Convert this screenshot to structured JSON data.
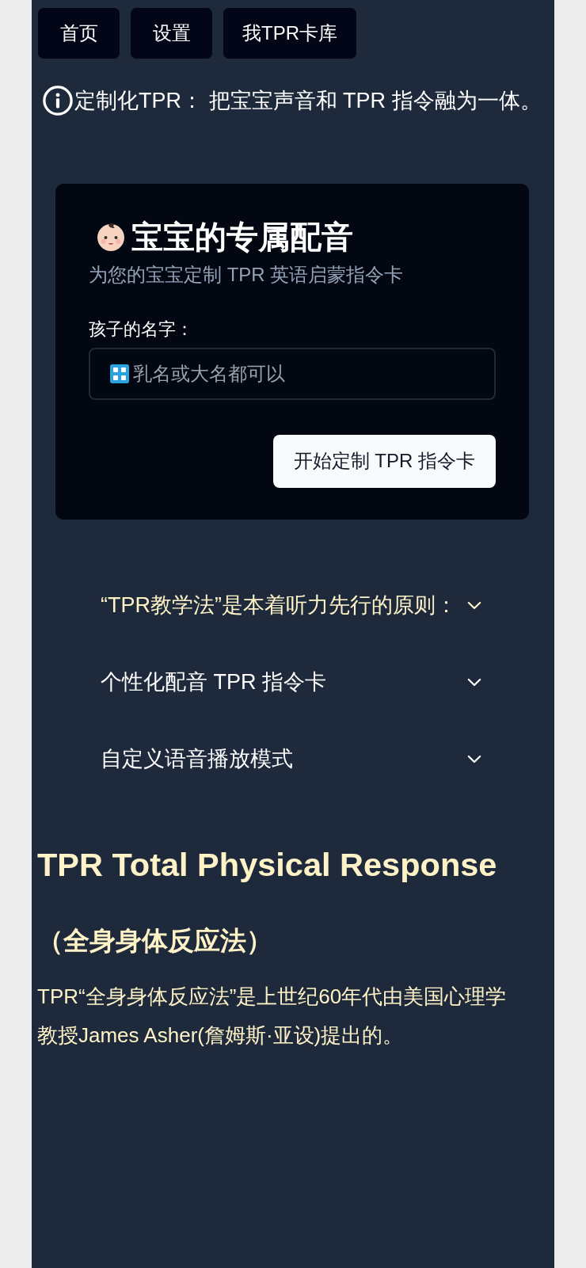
{
  "nav": [
    {
      "label": "首页"
    },
    {
      "label": "设置"
    },
    {
      "label": "我TPR卡库"
    }
  ],
  "notice": {
    "text": "定制化TPR： 把宝宝声音和 TPR 指令融为一体。"
  },
  "card": {
    "title": "宝宝的专属配音",
    "subtitle": "为您的宝宝定制 TPR 英语启蒙指令卡",
    "field": {
      "label": "孩子的名字：",
      "placeholder": "乳名或大名都可以"
    },
    "button": "开始定制 TPR 指令卡"
  },
  "accordion": [
    {
      "title": "“TPR教学法”是本着听力先行的原则：",
      "expanded": false,
      "highlighted": true
    },
    {
      "title": "个性化配音 TPR 指令卡",
      "expanded": false,
      "highlighted": false
    },
    {
      "title": "自定义语音播放模式",
      "expanded": false,
      "highlighted": false
    }
  ],
  "article": {
    "heading": "TPR Total Physical Response",
    "subheading": "（全身身体反应法）",
    "paragraph": "TPR“全身身体反应法”是上世纪60年代由美国心理学教授James Asher(詹姆斯·亚设)提出的。"
  }
}
